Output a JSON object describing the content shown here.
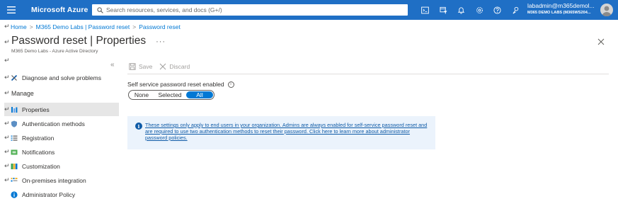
{
  "topbar": {
    "brand": "Microsoft Azure",
    "search_placeholder": "Search resources, services, and docs (G+/)",
    "icons": [
      "cloud-shell-icon",
      "directory-filter-icon",
      "notifications-icon",
      "settings-icon",
      "help-icon",
      "feedback-icon"
    ],
    "user_name": "labadmin@m365demol...",
    "user_org": "M365 DEMO LABS (M365WS204..."
  },
  "breadcrumb": [
    "Home",
    "M365 Demo Labs | Password reset",
    "Password reset"
  ],
  "page": {
    "title": "Password reset | Properties",
    "more": "···",
    "subtitle": "M365 Demo Labs - Azure Active Directory"
  },
  "sidebar": {
    "collapse": "«",
    "top_item": "Diagnose and solve problems",
    "section": "Manage",
    "items": [
      {
        "label": "Properties",
        "icon": "properties-icon",
        "active": true
      },
      {
        "label": "Authentication methods",
        "icon": "shield-icon"
      },
      {
        "label": "Registration",
        "icon": "registration-icon"
      },
      {
        "label": "Notifications",
        "icon": "notifications-icon"
      },
      {
        "label": "Customization",
        "icon": "customization-icon"
      },
      {
        "label": "On-premises integration",
        "icon": "on-premises-icon"
      },
      {
        "label": "Administrator Policy",
        "icon": "info-icon"
      }
    ]
  },
  "toolbar": {
    "save": "Save",
    "discard": "Discard"
  },
  "field": {
    "label": "Self service password reset enabled",
    "options": [
      "None",
      "Selected",
      "All"
    ],
    "selected": "All"
  },
  "info": {
    "text": "These settings only apply to end users in your organization. Admins are always enabled for self-service password reset and are required to use two authentication methods to reset their password. Click here to learn more about administrator password policies."
  },
  "colors": {
    "accent": "#0078d4",
    "topbar": "#1f6fc5",
    "info_bg": "#ebf3fc"
  }
}
